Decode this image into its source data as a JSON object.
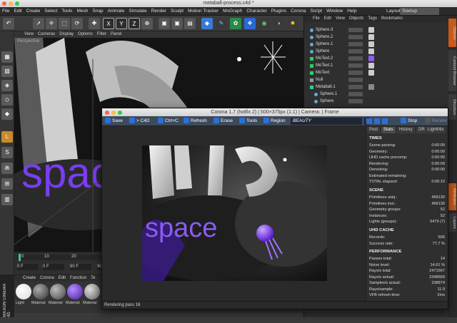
{
  "window_title": "metaball-process.c4d *",
  "menus": [
    "File",
    "Edit",
    "Create",
    "Select",
    "Tools",
    "Mesh",
    "Snap",
    "Animate",
    "Simulate",
    "Render",
    "Sculpt",
    "Motion Tracker",
    "MoGraph",
    "Character",
    "Plugins",
    "Corona",
    "Script",
    "Window",
    "Help"
  ],
  "layout_label": "Layout:",
  "layout_value": "Startup",
  "viewport_menus": [
    "View",
    "Cameras",
    "Display",
    "Options",
    "Filter",
    "Panel"
  ],
  "viewport_label": "Perspective",
  "obj_menus": [
    "File",
    "Edit",
    "View",
    "Objects",
    "Tags",
    "Bookmarks"
  ],
  "objects": [
    "Sphere.3",
    "Sphere.2",
    "Sphere.1",
    "Sphere",
    "MoText.2",
    "MoText.1",
    "MoText",
    "Null",
    "Metaball.1",
    "Sphere.1",
    "Sphere"
  ],
  "timeline": {
    "start": "0",
    "t10": "10",
    "t20": "20",
    "f0": "0 F",
    "f0b": "0 F",
    "f90": "90 F",
    "f90b": "90 F"
  },
  "mat_menus": [
    "Create",
    "Corona",
    "Edit",
    "Function",
    "Te"
  ],
  "materials": [
    "Light",
    "Material",
    "Material",
    "Material",
    "Material"
  ],
  "brand": "MAXON CINEMA 4D",
  "corona": {
    "title": "Corona 1.7 (hotfix 2) | 500×375px (1:1) | Camera: | Frame",
    "toolbar": {
      "save": "Save",
      "c4d": "> C4D",
      "ctrlc": "Ctrl+C",
      "refresh": "Refresh",
      "erase": "Erase",
      "tools": "Tools",
      "region": "Region",
      "pass": "BEAUTY",
      "stop": "Stop",
      "render": "Render"
    },
    "tabs": [
      "Post",
      "Stats",
      "History",
      "DR",
      "LightMix"
    ],
    "render_text": "space",
    "status": "Rendering pass 16",
    "times_h": "TIMES",
    "times": [
      [
        "Scene parsing:",
        "0:00:00"
      ],
      [
        "Geometry:",
        "0:00:00"
      ],
      [
        "UHD cache precomp:",
        "0:00:00"
      ],
      [
        "Rendering:",
        "0:00:09"
      ],
      [
        "Denoising:",
        "0:00:00"
      ],
      [
        "Estimated remaining:",
        ""
      ],
      [
        "TOTAL elapsed:",
        "0:00:10"
      ]
    ],
    "scene_h": "SCENE",
    "scene": [
      [
        "Primitives uniq.:",
        "469130"
      ],
      [
        "Primitives inst.:",
        "469130"
      ],
      [
        "Geometry groups:",
        "52"
      ],
      [
        "Instances:",
        "52"
      ],
      [
        "Lights (groups):",
        "5479 (7)"
      ]
    ],
    "uhd_h": "UHD CACHE",
    "uhd": [
      [
        "Records:",
        "606"
      ],
      [
        "Success rate:",
        "77.7 %"
      ]
    ],
    "perf_h": "PERFORMANCE",
    "perf": [
      [
        "Passes total:",
        "14"
      ],
      [
        "Noise level:",
        "14.61 %"
      ],
      [
        "Rays/s total:",
        "2471567"
      ],
      [
        "Rays/s actual:",
        "2348669"
      ],
      [
        "Samples/s actual:",
        "238874"
      ],
      [
        "Rays/sample:",
        "11.9"
      ],
      [
        "VFB refresh time:",
        "2ms"
      ]
    ]
  },
  "vtabs": [
    "Objects",
    "Content Browser",
    "Structure",
    "Attributes",
    "Layers"
  ],
  "colors": {
    "accent": "#2d6fd6",
    "purple": "#7a3df0",
    "panel": "#2f2f2f"
  }
}
